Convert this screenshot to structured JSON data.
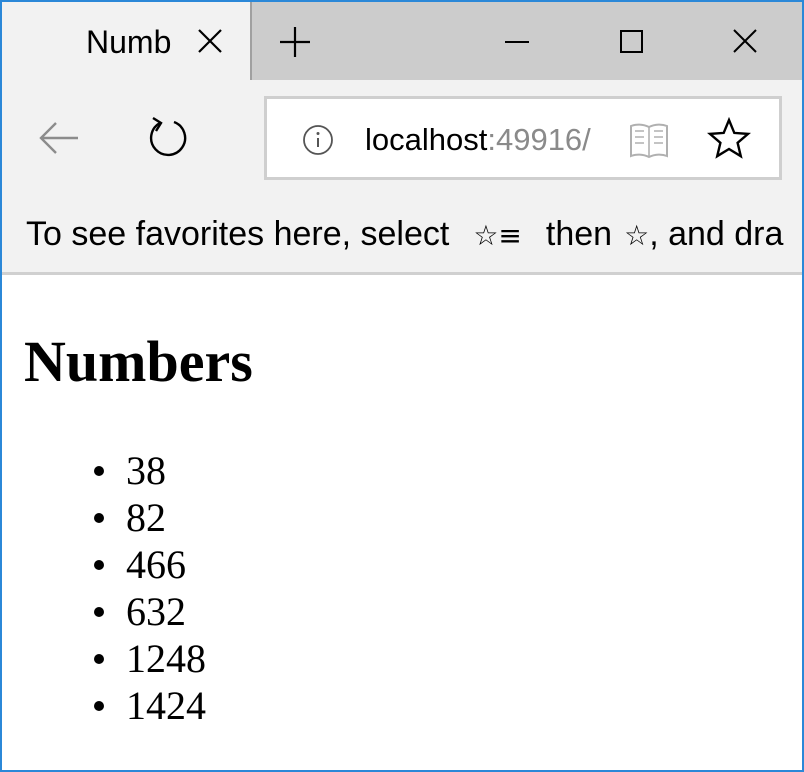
{
  "tab": {
    "title": "Numbers"
  },
  "address": {
    "host": "localhost",
    "port": ":49916/"
  },
  "favorites_bar": {
    "hint_start": "To see favorites here, select",
    "hint_middle": "then",
    "hint_end": ", and dra"
  },
  "icons": {
    "tab_close": "close-icon",
    "new_tab": "plus-icon",
    "minimize": "minimize-icon",
    "maximize": "maximize-icon",
    "window_close": "close-icon",
    "back": "back-arrow-icon",
    "refresh": "refresh-icon",
    "site_info": "info-icon",
    "reading_view": "book-icon",
    "favorite": "star-icon",
    "favorites_hub": "favorites-hub-icon"
  },
  "colors": {
    "window_border": "#2b88d8",
    "chrome_bg": "#f2f2f2",
    "titlebar_bg": "#cccccc",
    "port_text": "#8a8a8a"
  },
  "page": {
    "heading": "Numbers",
    "numbers": [
      "38",
      "82",
      "466",
      "632",
      "1248",
      "1424"
    ]
  }
}
